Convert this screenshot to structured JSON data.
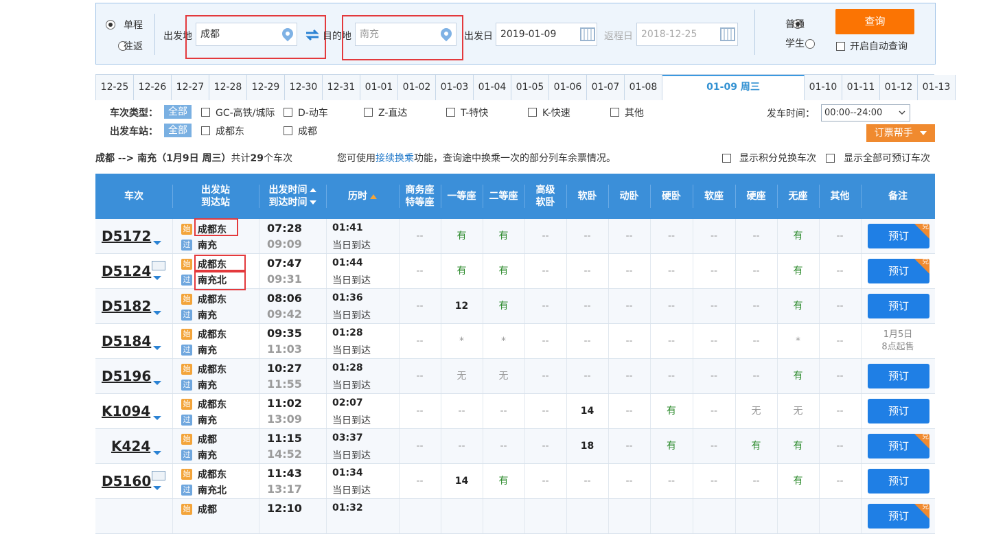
{
  "search": {
    "trip_types": [
      {
        "label": "单程",
        "selected": true
      },
      {
        "label": "往返",
        "selected": false
      }
    ],
    "from_label": "出发地",
    "from_value": "成都",
    "to_label": "目的地",
    "to_placeholder": "南充",
    "depart_label": "出发日",
    "depart_value": "2019-01-09",
    "return_label": "返程日",
    "return_value": "2018-12-25",
    "passenger_types": [
      {
        "label": "普通",
        "selected": true
      },
      {
        "label": "学生",
        "selected": false
      }
    ],
    "query_label": "查询",
    "auto_query_label": "开启自动查询"
  },
  "date_tabs": [
    "12-25",
    "12-26",
    "12-27",
    "12-28",
    "12-29",
    "12-30",
    "12-31",
    "01-01",
    "01-02",
    "01-03",
    "01-04",
    "01-05",
    "01-06",
    "01-07",
    "01-08",
    "01-09 周三",
    "01-10",
    "01-11",
    "01-12",
    "01-13"
  ],
  "selected_date_index": 15,
  "filters": {
    "train_type_label": "车次类型：",
    "all_label": "全部",
    "train_types": [
      "GC-高铁/城际",
      "D-动车",
      "Z-直达",
      "T-特快",
      "K-快速",
      "其他"
    ],
    "station_label": "出发车站：",
    "stations": [
      "成都东",
      "成都"
    ],
    "time_label": "发车时间：",
    "time_value": "00:00--24:00",
    "helper_label": "订票帮手"
  },
  "summary": {
    "route": "成都 --> 南充（1月9日  周三）",
    "count_prefix": "共计",
    "count": "29",
    "count_suffix": "个车次",
    "tip_prefix": "您可使用",
    "tip_link": "接续换乘",
    "tip_suffix": "功能，查询途中换乘一次的部分列车余票情况。",
    "opt1": "显示积分兑换车次",
    "opt2": "显示全部可预订车次"
  },
  "headers": {
    "train": "车次",
    "station1": "出发站",
    "station2": "到达站",
    "time1": "出发时间",
    "time2": "到达时间",
    "duration": "历时",
    "business1": "商务座",
    "business2": "特等座",
    "first": "一等座",
    "second": "二等座",
    "soft_sleeper_adv1": "高级",
    "soft_sleeper_adv2": "软卧",
    "soft_sleeper": "软卧",
    "moving_sleeper": "动卧",
    "hard_sleeper": "硬卧",
    "soft_seat": "软座",
    "hard_seat": "硬座",
    "no_seat": "无座",
    "other": "其他",
    "remark": "备注"
  },
  "start_badge": "始",
  "pass_badge": "过",
  "book_label": "预订",
  "dui_label": "兑",
  "same_day_label": "当日到达",
  "trains": [
    {
      "no": "D5172",
      "from": "成都东",
      "to": "南充",
      "dep": "07:28",
      "arr": "09:09",
      "dur": "01:41",
      "seats": [
        "--",
        "有",
        "有",
        "--",
        "--",
        "--",
        "--",
        "--",
        "--",
        "有",
        "--"
      ],
      "idcard": false,
      "dui": true,
      "note": ""
    },
    {
      "no": "D5124",
      "from": "成都东",
      "to": "南充北",
      "dep": "07:47",
      "arr": "09:31",
      "dur": "01:44",
      "seats": [
        "--",
        "有",
        "有",
        "--",
        "--",
        "--",
        "--",
        "--",
        "--",
        "有",
        "--"
      ],
      "idcard": true,
      "dui": true,
      "note": ""
    },
    {
      "no": "D5182",
      "from": "成都东",
      "to": "南充",
      "dep": "08:06",
      "arr": "09:42",
      "dur": "01:36",
      "seats": [
        "--",
        "12",
        "有",
        "--",
        "--",
        "--",
        "--",
        "--",
        "--",
        "有",
        "--"
      ],
      "idcard": false,
      "dui": false,
      "note": ""
    },
    {
      "no": "D5184",
      "from": "成都东",
      "to": "南充",
      "dep": "09:35",
      "arr": "11:03",
      "dur": "01:28",
      "seats": [
        "--",
        "*",
        "*",
        "--",
        "--",
        "--",
        "--",
        "--",
        "--",
        "*",
        "--"
      ],
      "idcard": false,
      "dui": false,
      "note": "1月5日|8点起售"
    },
    {
      "no": "D5196",
      "from": "成都东",
      "to": "南充",
      "dep": "10:27",
      "arr": "11:55",
      "dur": "01:28",
      "seats": [
        "--",
        "无",
        "无",
        "--",
        "--",
        "--",
        "--",
        "--",
        "--",
        "有",
        "--"
      ],
      "idcard": false,
      "dui": false,
      "note": ""
    },
    {
      "no": "K1094",
      "from": "成都东",
      "to": "南充",
      "dep": "11:02",
      "arr": "13:09",
      "dur": "02:07",
      "seats": [
        "--",
        "--",
        "--",
        "--",
        "14",
        "--",
        "有",
        "--",
        "无",
        "无",
        "--"
      ],
      "idcard": false,
      "dui": false,
      "note": ""
    },
    {
      "no": "K424",
      "from": "成都",
      "to": "南充",
      "dep": "11:15",
      "arr": "14:52",
      "dur": "03:37",
      "seats": [
        "--",
        "--",
        "--",
        "--",
        "18",
        "--",
        "有",
        "--",
        "有",
        "有",
        "--"
      ],
      "idcard": false,
      "dui": true,
      "note": ""
    },
    {
      "no": "D5160",
      "from": "成都东",
      "to": "南充北",
      "dep": "11:43",
      "arr": "13:17",
      "dur": "01:34",
      "seats": [
        "--",
        "14",
        "有",
        "--",
        "--",
        "--",
        "--",
        "--",
        "--",
        "有",
        "--"
      ],
      "idcard": true,
      "dui": false,
      "note": ""
    },
    {
      "no": "",
      "from": "成都",
      "to": "",
      "dep": "12:10",
      "arr": "",
      "dur": "01:32",
      "seats": [
        "",
        "",
        "",
        "",
        "",
        "",
        "",
        "",
        "",
        "",
        ""
      ],
      "idcard": false,
      "dui": true,
      "note": ""
    }
  ]
}
